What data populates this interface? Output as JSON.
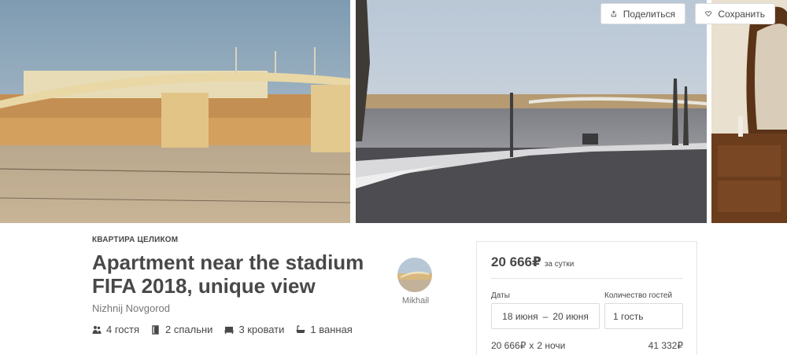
{
  "gallery": {
    "share_label": "Поделиться",
    "save_label": "Сохранить"
  },
  "listing": {
    "kind": "КВАРТИРА ЦЕЛИКОМ",
    "title": "Apartment near the stadium FIFA 2018, unique view",
    "city": "Nizhnij Novgorod",
    "amenities": {
      "guests": "4 гостя",
      "bedrooms": "2 спальни",
      "beds": "3 кровати",
      "baths": "1 ванная"
    }
  },
  "host": {
    "name": "Mikhail"
  },
  "booking": {
    "price": "20 666₽",
    "per_night": "за сутки",
    "dates_label": "Даты",
    "check_in": "18 июня",
    "dash": "–",
    "check_out": "20 июня",
    "guests_label": "Количество гостей",
    "guests_value": "1 гость",
    "calc_price": "20 666₽",
    "calc_times": "x",
    "calc_nights": "2 ночи",
    "total": "41 332₽"
  },
  "icons": {
    "share": "share-icon",
    "heart": "heart-icon",
    "guests": "guests-icon",
    "bedroom": "bedroom-icon",
    "bed": "bed-icon",
    "bath": "bath-icon"
  },
  "colors": {
    "text": "#484848",
    "muted": "#767676",
    "border": "#dcdcdc"
  }
}
